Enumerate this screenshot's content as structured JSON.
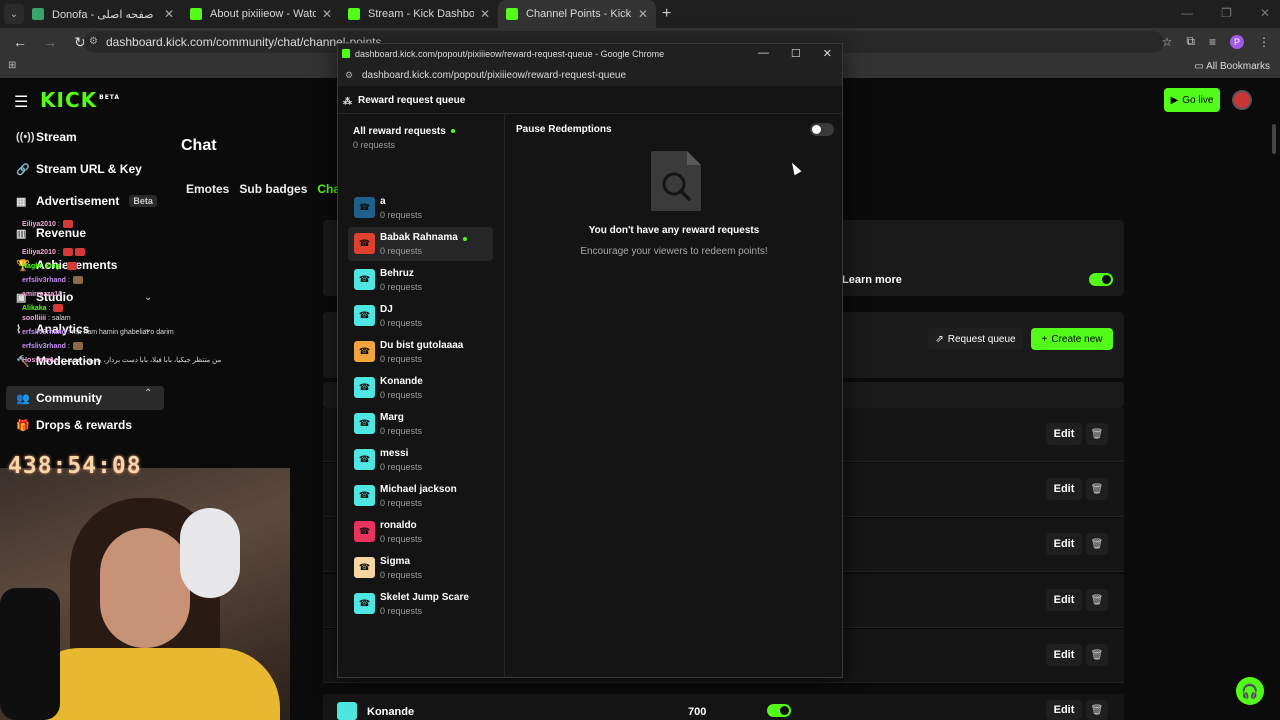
{
  "browser": {
    "tabs": [
      {
        "title": "Donofa - صفحه اصلی"
      },
      {
        "title": "About pixiiieow - Watch Live on"
      },
      {
        "title": "Stream - Kick Dashboard"
      },
      {
        "title": "Channel Points - Kick Dashboard"
      }
    ],
    "url": "dashboard.kick.com/community/chat/channel-points",
    "bookmarks_label": "All Bookmarks",
    "profile_initial": "P"
  },
  "kick": {
    "logo": "KICK",
    "logo_sup": "BETA",
    "go_live": "Go live"
  },
  "sidebar": {
    "items": [
      {
        "label": "Stream"
      },
      {
        "label": "Stream URL & Key"
      },
      {
        "label": "Advertisement",
        "badge": "Beta"
      },
      {
        "label": "Revenue"
      },
      {
        "label": "Achievements"
      },
      {
        "label": "Studio"
      },
      {
        "label": "Analytics"
      },
      {
        "label": "Moderation"
      },
      {
        "label": "Community"
      },
      {
        "label": "Drops & rewards"
      }
    ]
  },
  "stream_overlay": {
    "chat": [
      {
        "user": "Eiliya2010",
        "text": ""
      },
      {
        "user": "Eiliya2010",
        "text": ""
      },
      {
        "user": "Naghi_king",
        "text": ""
      },
      {
        "user": "erfsliv3rhand",
        "text": ""
      },
      {
        "user": "amirrezza10",
        "text": ""
      },
      {
        "user": "Alikaka",
        "text": ""
      },
      {
        "user": "soolliiii",
        "text": "salam"
      },
      {
        "user": "erfsliv3rhand",
        "text": "ma ham hamin ghabeliat o darim"
      },
      {
        "user": "erfsliv3rhand",
        "text": ""
      },
      {
        "user": "HosseinAe",
        "text": "من منتظر جیکیا، بابا فیلا، بابا دست بردار، یه پوته هستم"
      }
    ],
    "timer": "438:54:08"
  },
  "main": {
    "title": "Chat",
    "tabs": [
      "Emotes",
      "Sub badges",
      "Channel Points"
    ],
    "learn_more": "Learn more",
    "request_queue": "Request queue",
    "create_new": "Create new",
    "edit_label": "Edit",
    "last_reward": {
      "name": "Konande",
      "cost": "700"
    }
  },
  "popout": {
    "window_title": "dashboard.kick.com/popout/pixiiieow/reward-request-queue - Google Chrome",
    "url": "dashboard.kick.com/popout/pixiiieow/reward-request-queue",
    "header": "Reward request queue",
    "all_requests": "All reward requests",
    "all_count": "0 requests",
    "pause_label": "Pause Redemptions",
    "empty_title": "You don't have any reward requests",
    "empty_sub": "Encourage your viewers to redeem points!",
    "rewards": [
      {
        "name": "a",
        "count": "0 requests",
        "color": "#1f5f8b"
      },
      {
        "name": "Babak Rahnama",
        "count": "0 requests",
        "color": "#e0402e",
        "selected": true,
        "online": true
      },
      {
        "name": "Behruz",
        "count": "0 requests",
        "color": "#4ee6e0"
      },
      {
        "name": "DJ",
        "count": "0 requests",
        "color": "#4ee6e0"
      },
      {
        "name": "Du bist gutolaaaa",
        "count": "0 requests",
        "color": "#f2a33a"
      },
      {
        "name": "Konande",
        "count": "0 requests",
        "color": "#4ee6e0"
      },
      {
        "name": "Marg",
        "count": "0 requests",
        "color": "#4ee6e0"
      },
      {
        "name": "messi",
        "count": "0 requests",
        "color": "#4ee6e0"
      },
      {
        "name": "Michael jackson",
        "count": "0 requests",
        "color": "#4ee6e0"
      },
      {
        "name": "ronaldo",
        "count": "0 requests",
        "color": "#e8335f"
      },
      {
        "name": "Sigma",
        "count": "0 requests",
        "color": "#f5d6a0"
      },
      {
        "name": "Skelet Jump Scare",
        "count": "0 requests",
        "color": "#4ee6e0"
      }
    ]
  },
  "colors": {
    "accent": "#53fc18",
    "background": "#0b0b0c"
  }
}
